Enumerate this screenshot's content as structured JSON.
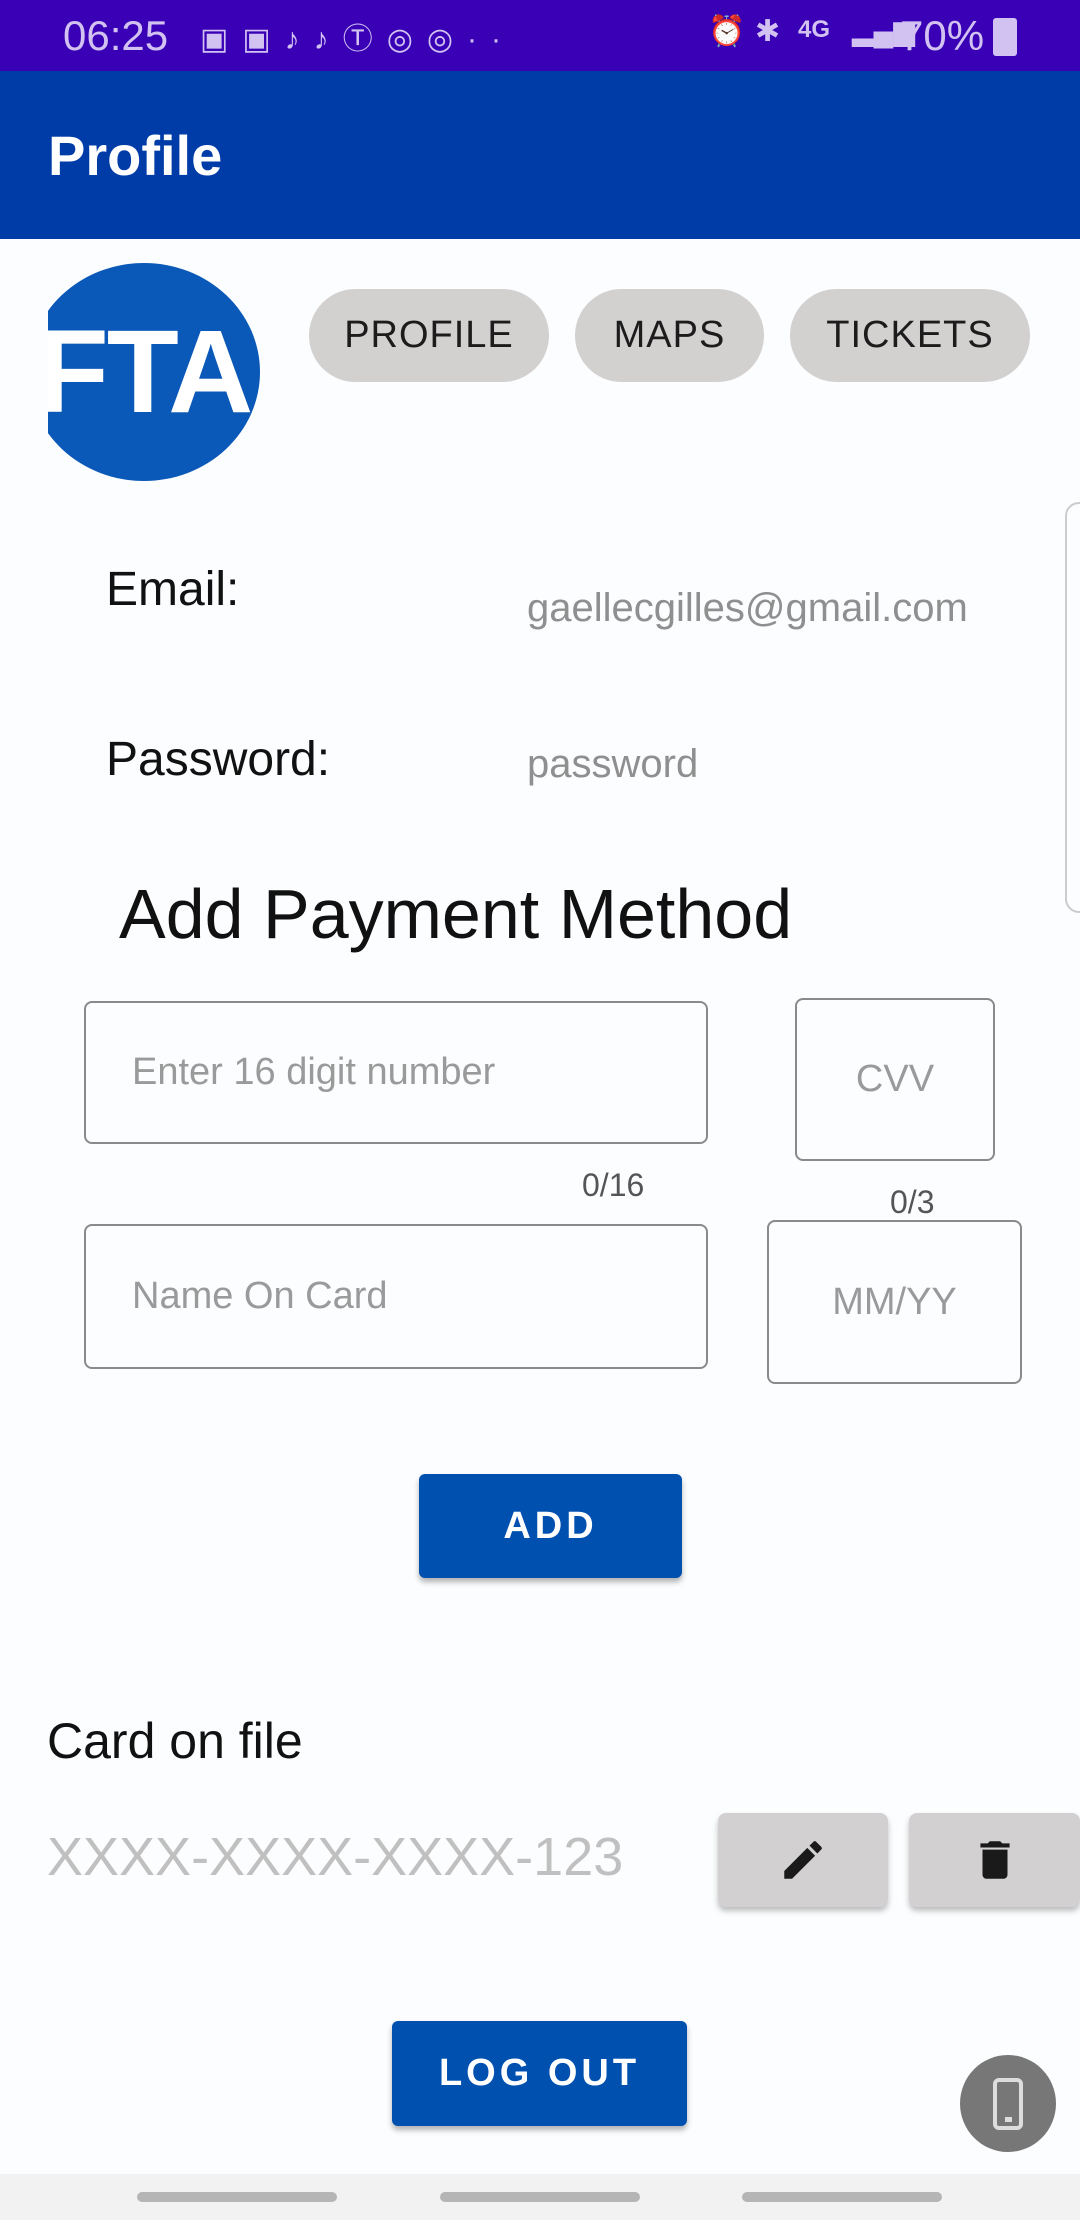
{
  "status_bar": {
    "time": "06:25",
    "battery": "70%",
    "network": "4G"
  },
  "app_bar": {
    "title": "Profile"
  },
  "logo": {
    "text": "FTA",
    "color": "#0a58b8"
  },
  "nav_chips": [
    {
      "label": "PROFILE"
    },
    {
      "label": "MAPS"
    },
    {
      "label": "TICKETS"
    }
  ],
  "account": {
    "email_label": "Email:",
    "email_value": "gaellecgilles@gmail.com",
    "password_label": "Password:",
    "password_value": "password"
  },
  "payment": {
    "heading": "Add Payment Method",
    "card_number_placeholder": "Enter 16 digit number",
    "card_number_counter": "0/16",
    "cvv_placeholder": "CVV",
    "cvv_counter": "0/3",
    "name_placeholder": "Name On Card",
    "expiry_placeholder": "MM/YY",
    "add_label": "ADD"
  },
  "card_on_file": {
    "heading": "Card on file",
    "masked_number": "XXXX-XXXX-XXXX-123",
    "edit_icon": "pencil-icon",
    "delete_icon": "trash-icon"
  },
  "logout_label": "LOG OUT",
  "colors": {
    "primary": "#0050b0",
    "app_bar": "#003ca7",
    "status_bar": "#3900b5"
  }
}
